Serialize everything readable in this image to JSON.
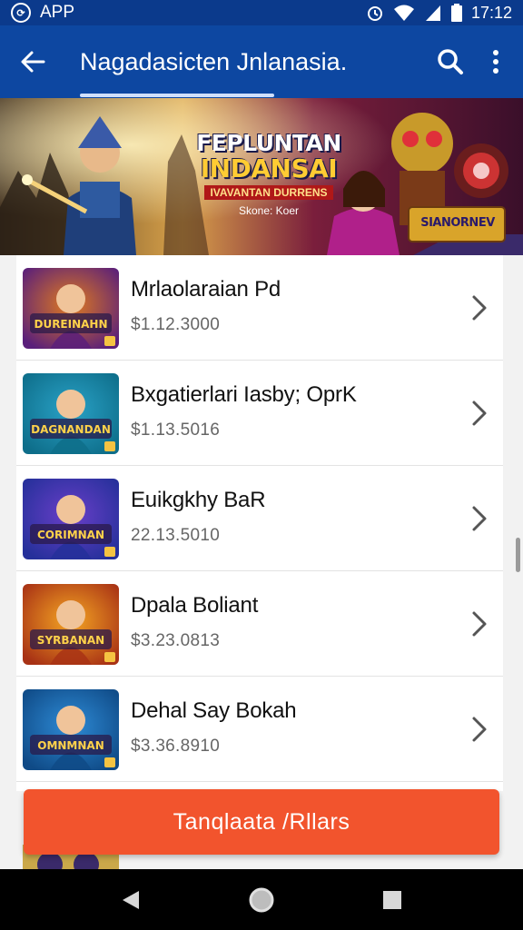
{
  "status_bar": {
    "app_label": "APP",
    "time": "17:12",
    "icons": [
      "app-logo-icon",
      "alarm-icon",
      "wifi-icon",
      "signal-icon",
      "battery-icon"
    ]
  },
  "app_bar": {
    "title": "Nagadasicten Jnlanasia.",
    "icons": [
      "back-arrow-icon",
      "search-icon",
      "more-vert-icon"
    ]
  },
  "banner": {
    "title_line1": "FEPLUNTAN",
    "title_line2": "INDANSAI",
    "subtitle": "IVAVANTAN DURRENS",
    "tag": "Skone: Koer",
    "logo_text": "SIANORNEV"
  },
  "items": [
    {
      "title": "Mrlaolaraian Pd",
      "price": "$1.12.3000",
      "thumb_text": "DUREINAHN",
      "colors": [
        "#5a1f7a",
        "#e07a1f"
      ]
    },
    {
      "title": "Bxgatierlari Iasby; OprK",
      "price": "$1.13.5016",
      "thumb_text": "DAGNANDAN",
      "colors": [
        "#0e6e8a",
        "#2aa2c7"
      ]
    },
    {
      "title": "Euikgkhy BaR",
      "price": "22.13.5010",
      "thumb_text": "CORIMNAN",
      "colors": [
        "#25309a",
        "#6a3fc9"
      ]
    },
    {
      "title": "Dpala Boliant",
      "price": "$3.23.0813",
      "thumb_text": "SYRBANAN",
      "colors": [
        "#a83215",
        "#f5a623"
      ]
    },
    {
      "title": "Dehal Say Bokah",
      "price": "$3.36.8910",
      "thumb_text": "OMNMNAN",
      "colors": [
        "#0f4a86",
        "#2e8bd6"
      ]
    }
  ],
  "cta": {
    "label": "Tanqlaata /Rllars"
  },
  "nav_bar": {
    "icons": [
      "back-triangle-icon",
      "home-circle-icon",
      "recents-square-icon"
    ]
  },
  "colors": {
    "status_bar": "#0b3a8c",
    "app_bar": "#0d47a1",
    "cta": "#f2542d",
    "list_bg": "#ffffff",
    "page_bg": "#f2f2f2",
    "nav_bar": "#000000"
  }
}
